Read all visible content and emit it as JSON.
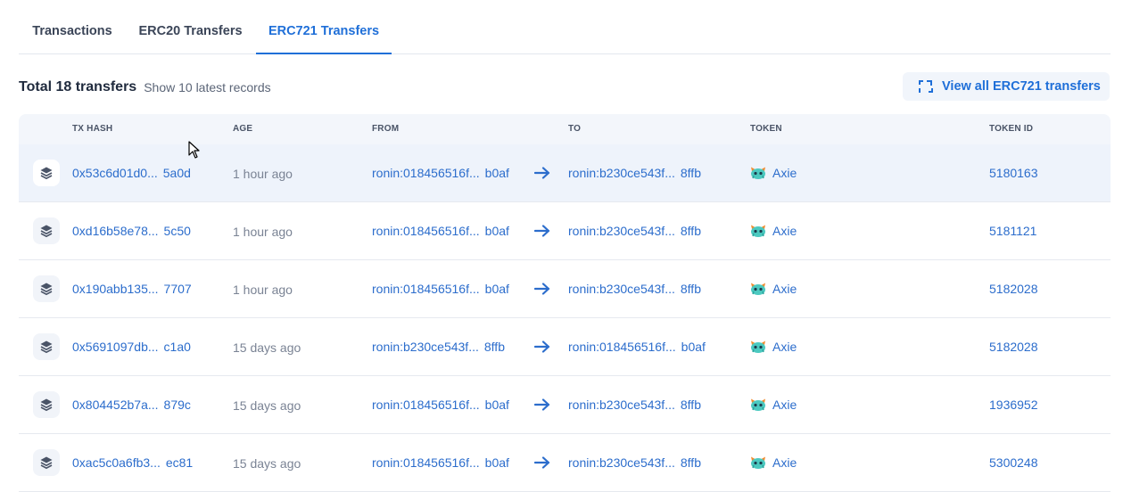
{
  "tabs": [
    {
      "label": "Transactions"
    },
    {
      "label": "ERC20 Transfers"
    },
    {
      "label": "ERC721 Transfers"
    }
  ],
  "summary": {
    "total": "Total 18 transfers",
    "note": "Show 10 latest records"
  },
  "view_all": {
    "label": "View all ERC721 transfers",
    "icon": "expand-icon"
  },
  "columns": {
    "tx_hash": "TX HASH",
    "age": "AGE",
    "from": "FROM",
    "to": "TO",
    "token": "TOKEN",
    "token_id": "TOKEN ID"
  },
  "accent_color": "#1f6fd8",
  "rows": [
    {
      "hash_start": "0x53c6d01d0...",
      "hash_end": "5a0d",
      "age": "1 hour ago",
      "from_start": "ronin:018456516f...",
      "from_end": "b0af",
      "to_start": "ronin:b230ce543f...",
      "to_end": "8ffb",
      "token": "Axie",
      "token_id": "5180163"
    },
    {
      "hash_start": "0xd16b58e78...",
      "hash_end": "5c50",
      "age": "1 hour ago",
      "from_start": "ronin:018456516f...",
      "from_end": "b0af",
      "to_start": "ronin:b230ce543f...",
      "to_end": "8ffb",
      "token": "Axie",
      "token_id": "5181121"
    },
    {
      "hash_start": "0x190abb135...",
      "hash_end": "7707",
      "age": "1 hour ago",
      "from_start": "ronin:018456516f...",
      "from_end": "b0af",
      "to_start": "ronin:b230ce543f...",
      "to_end": "8ffb",
      "token": "Axie",
      "token_id": "5182028"
    },
    {
      "hash_start": "0x5691097db...",
      "hash_end": "c1a0",
      "age": "15 days ago",
      "from_start": "ronin:b230ce543f...",
      "from_end": "8ffb",
      "to_start": "ronin:018456516f...",
      "to_end": "b0af",
      "token": "Axie",
      "token_id": "5182028"
    },
    {
      "hash_start": "0x804452b7a...",
      "hash_end": "879c",
      "age": "15 days ago",
      "from_start": "ronin:018456516f...",
      "from_end": "b0af",
      "to_start": "ronin:b230ce543f...",
      "to_end": "8ffb",
      "token": "Axie",
      "token_id": "1936952"
    },
    {
      "hash_start": "0xac5c0a6fb3...",
      "hash_end": "ec81",
      "age": "15 days ago",
      "from_start": "ronin:018456516f...",
      "from_end": "b0af",
      "to_start": "ronin:b230ce543f...",
      "to_end": "8ffb",
      "token": "Axie",
      "token_id": "5300248"
    }
  ]
}
